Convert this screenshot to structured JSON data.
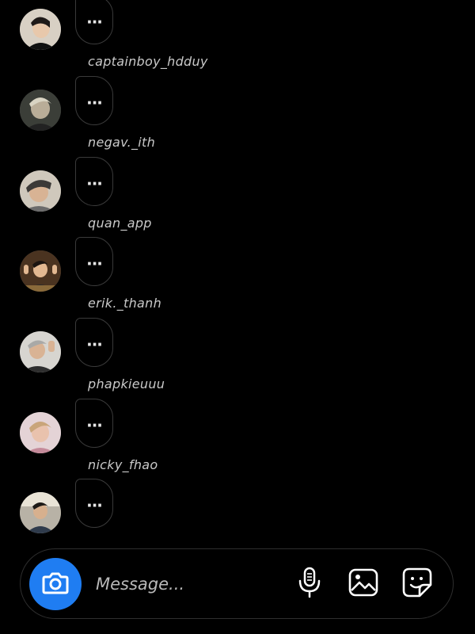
{
  "thread": {
    "rows": [
      {
        "username": "captainboy_hdduy",
        "bubble_text": "...",
        "avatar_icon": "avatar-photo"
      },
      {
        "username": "negav._ith",
        "bubble_text": "...",
        "avatar_icon": "avatar-photo"
      },
      {
        "username": "quan_app",
        "bubble_text": "...",
        "avatar_icon": "avatar-photo"
      },
      {
        "username": "erik._thanh",
        "bubble_text": "...",
        "avatar_icon": "avatar-photo"
      },
      {
        "username": "phapkieuuu",
        "bubble_text": "...",
        "avatar_icon": "avatar-photo"
      },
      {
        "username": "nicky_fhao",
        "bubble_text": "...",
        "avatar_icon": "avatar-photo"
      },
      {
        "username": "",
        "bubble_text": "...",
        "avatar_icon": "avatar-photo"
      }
    ]
  },
  "composer": {
    "placeholder": "Message...",
    "value": "",
    "camera_icon": "camera-icon",
    "tools": [
      "microphone-icon",
      "gallery-icon",
      "sticker-icon"
    ],
    "accent_color": "#1f7df2"
  }
}
